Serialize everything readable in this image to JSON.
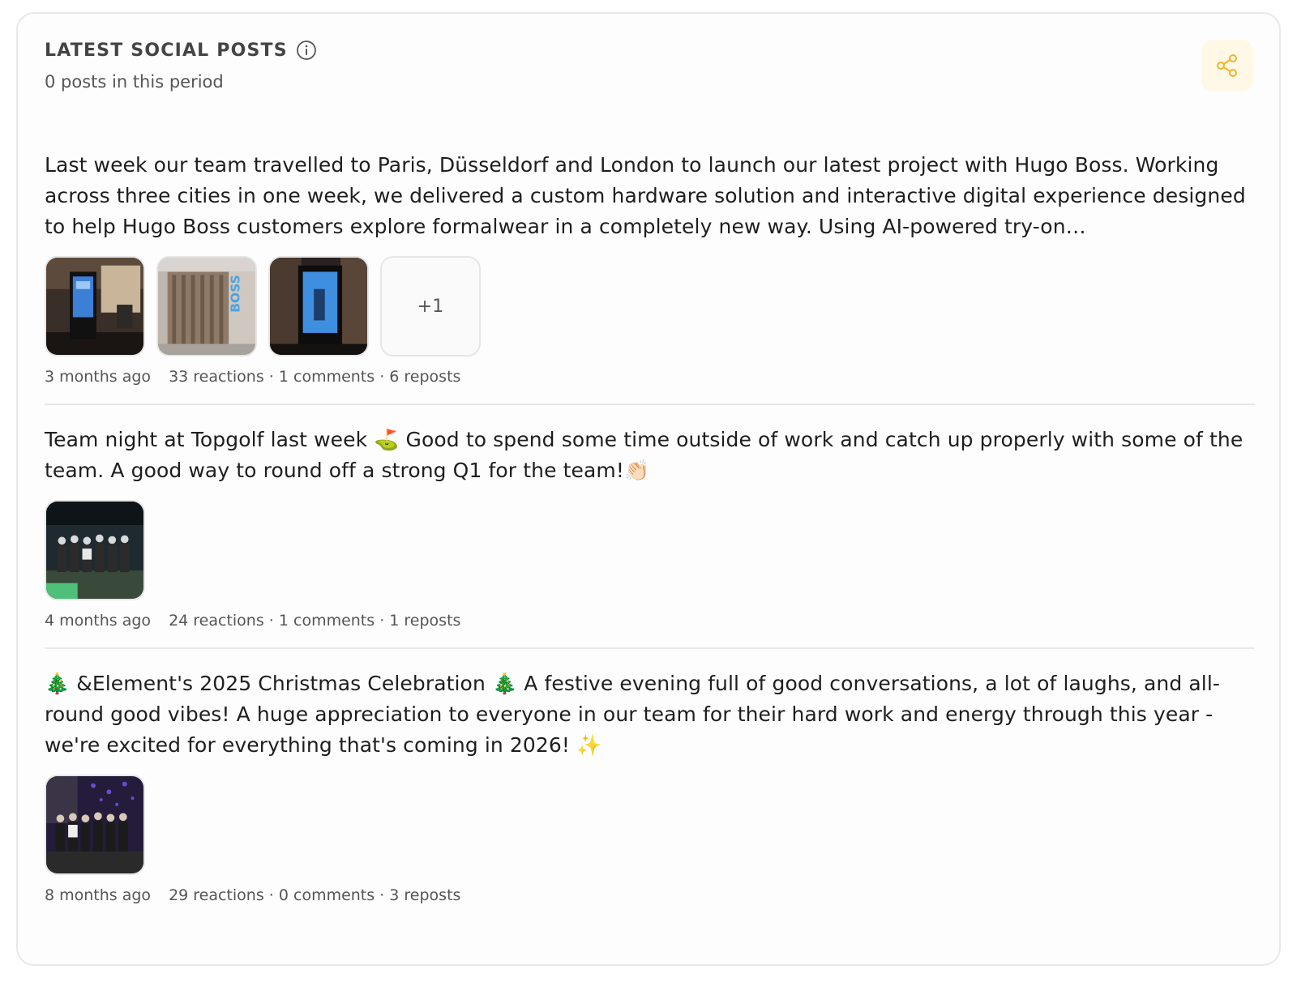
{
  "header": {
    "title": "LATEST SOCIAL POSTS",
    "subtitle": "0 posts in this period",
    "info_icon": "info-icon",
    "share_icon": "share-icon",
    "accent_color": "#f0b429"
  },
  "posts": [
    {
      "text": "Last week our team travelled to Paris, Düsseldorf and London to launch our latest project with Hugo Boss. Working across three cities in one week, we delivered a custom hardware solution and interactive digital experience designed to help Hugo Boss customers explore formalwear in a completely new way. Using AI-powered try-on…",
      "more_count": "+1",
      "time": "3 months ago",
      "stats": "33 reactions · 1 comments · 6 reposts"
    },
    {
      "text": "Team night at Topgolf last week ⛳ Good to spend some time outside of work and catch up properly with some of the team. A good way to round off a strong Q1 for the team!👏🏻",
      "time": "4 months ago",
      "stats": "24 reactions · 1 comments · 1 reposts"
    },
    {
      "text": "🎄 &Element's 2025 Christmas Celebration 🎄 A festive evening full of good conversations, a lot of laughs, and all-round good vibes! A huge appreciation to everyone in our team for their hard work and energy through this year - we're excited for everything that's coming in 2026! ✨",
      "time": "8 months ago",
      "stats": "29 reactions · 0 comments · 3 reposts"
    }
  ]
}
